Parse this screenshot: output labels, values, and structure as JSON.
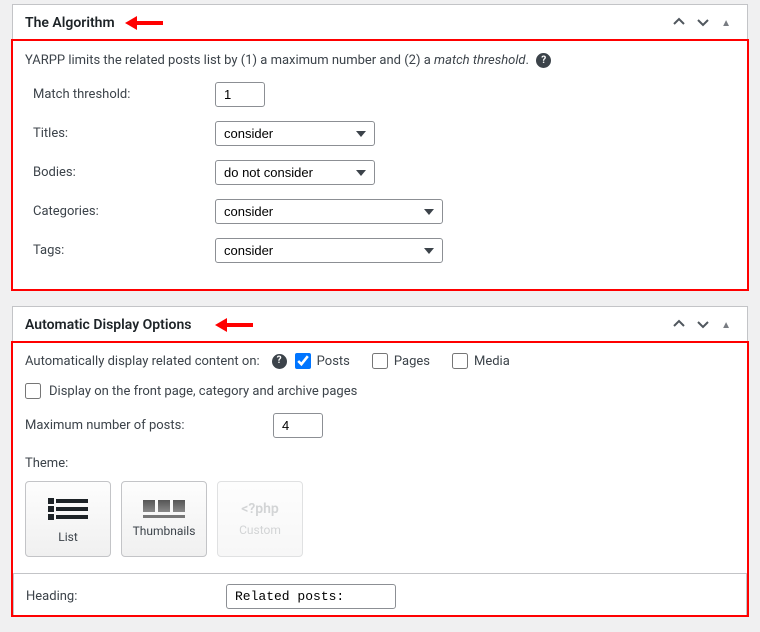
{
  "algorithm_panel": {
    "title": "The Algorithm",
    "description_prefix": "YARPP limits the related posts list by (1) a maximum number and (2) a ",
    "description_em": "match threshold",
    "description_suffix": ".",
    "match_threshold_label": "Match threshold:",
    "match_threshold_value": "1",
    "titles_label": "Titles:",
    "titles_value": "consider",
    "bodies_label": "Bodies:",
    "bodies_value": "do not consider",
    "categories_label": "Categories:",
    "categories_value": "consider",
    "tags_label": "Tags:",
    "tags_value": "consider"
  },
  "display_panel": {
    "title": "Automatic Display Options",
    "auto_display_label": "Automatically display related content on:",
    "cb_posts_label": "Posts",
    "cb_pages_label": "Pages",
    "cb_media_label": "Media",
    "front_page_label": "Display on the front page, category and archive pages",
    "max_posts_label": "Maximum number of posts:",
    "max_posts_value": "4",
    "theme_label": "Theme:",
    "theme_list": "List",
    "theme_thumbnails": "Thumbnails",
    "theme_custom_icon": "<?php",
    "theme_custom": "Custom",
    "heading_label": "Heading:",
    "heading_value": "Related posts:"
  }
}
